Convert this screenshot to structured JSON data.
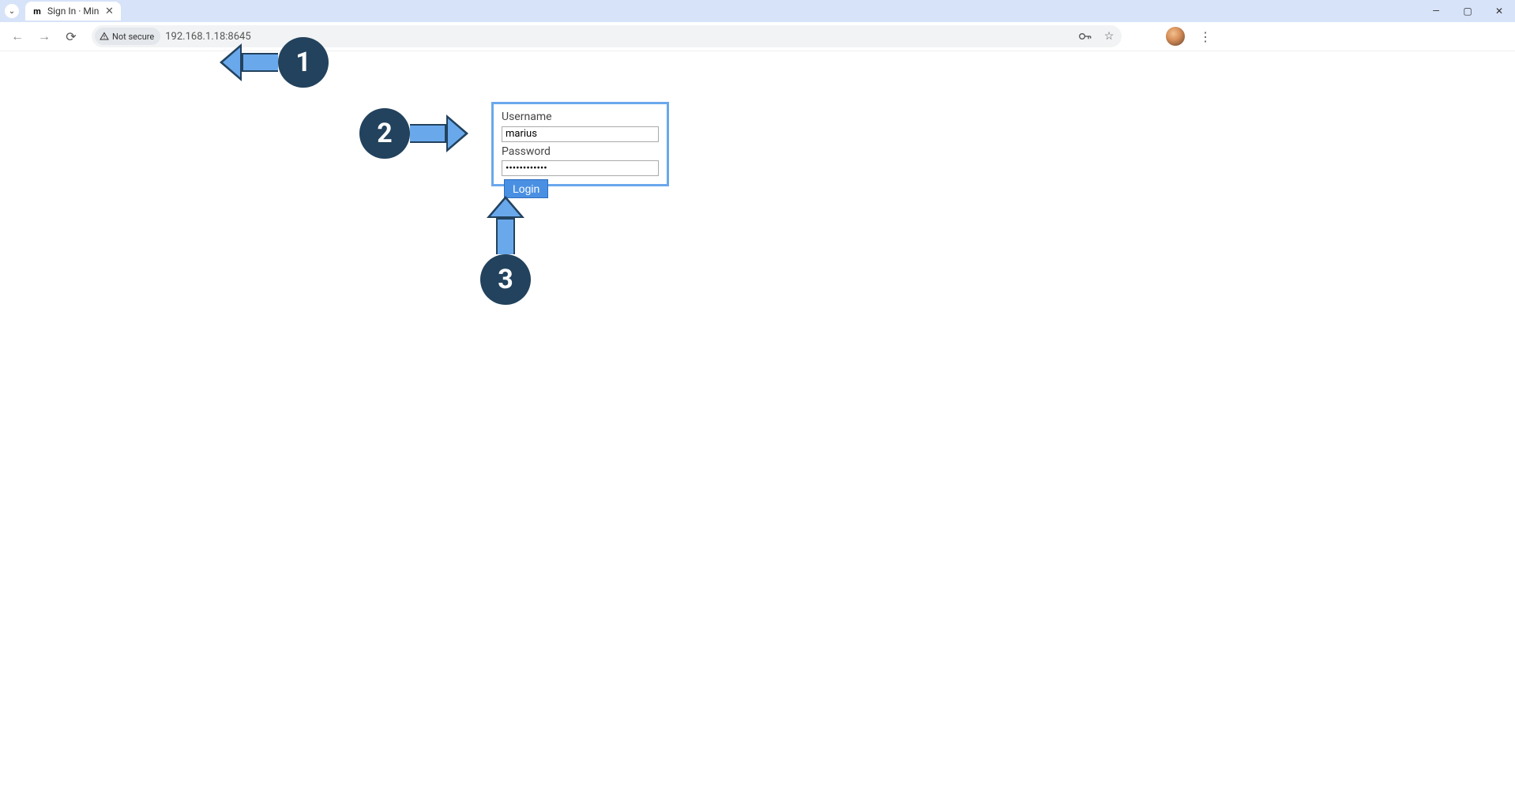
{
  "window": {
    "tab_title": "Sign In · Min"
  },
  "address": {
    "security_label": "Not secure",
    "url": "192.168.1.18:8645"
  },
  "login": {
    "username_label": "Username",
    "username_value": "marius",
    "password_label": "Password",
    "password_value": "••••••••••••",
    "button_label": "Login"
  },
  "annotations": {
    "step1": "1",
    "step2": "2",
    "step3": "3"
  }
}
